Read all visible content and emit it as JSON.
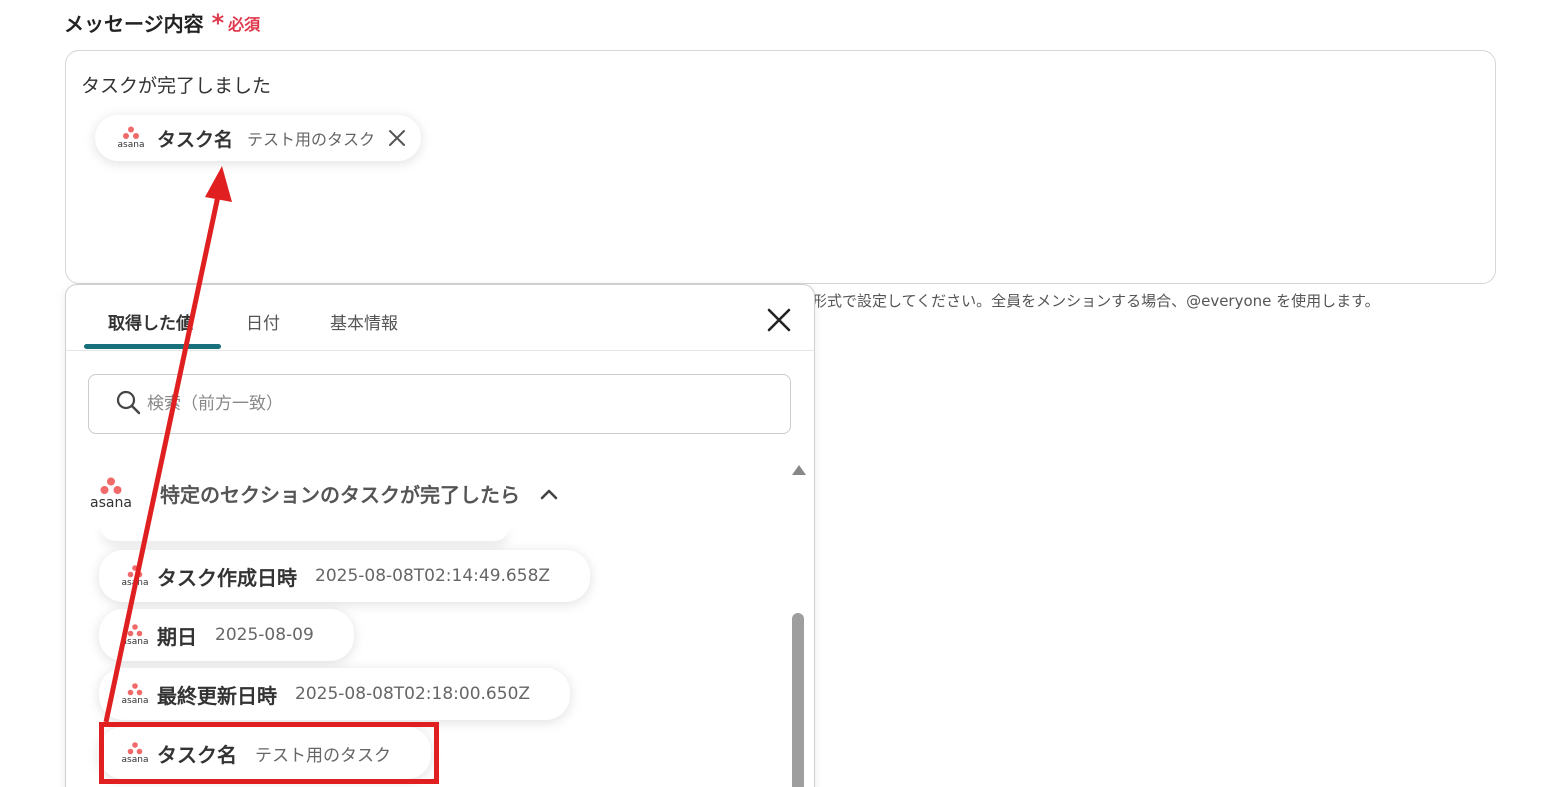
{
  "field": {
    "label": "メッセージ内容",
    "required_mark": "*",
    "required_text": "必須"
  },
  "message": {
    "text": "タスクが完了しました",
    "chip": {
      "name": "タスク名",
      "value": "テスト用のタスク"
    }
  },
  "hint": "形式で設定してください。全員をメンションする場合、@everyone を使用します。",
  "panel": {
    "tabs": [
      {
        "label": "取得した値"
      },
      {
        "label": "日付"
      },
      {
        "label": "基本情報"
      }
    ],
    "search_placeholder": "検索（前方一致）",
    "section_title": "特定のセクションのタスクが完了したら",
    "items": [
      {
        "name": "タスク作成日時",
        "value": "2025-08-08T02:14:49.658Z"
      },
      {
        "name": "期日",
        "value": "2025-08-09"
      },
      {
        "name": "最終更新日時",
        "value": "2025-08-08T02:18:00.650Z"
      },
      {
        "name": "タスク名",
        "value": "テスト用のタスク"
      }
    ]
  },
  "brand": {
    "name": "asana",
    "color": "#f06a6a"
  },
  "colors": {
    "accent": "#17707b",
    "required": "#e0394d",
    "annotation": "#e02020"
  }
}
